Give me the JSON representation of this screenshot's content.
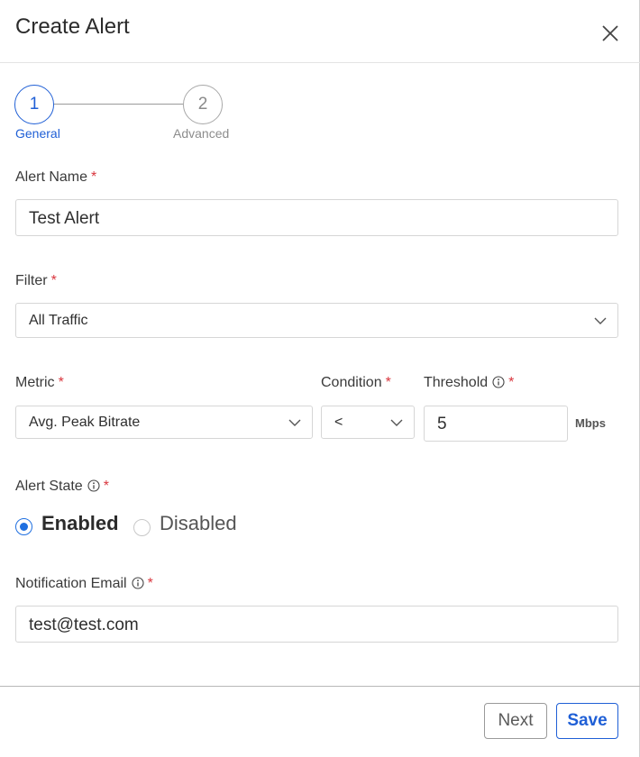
{
  "dialog": {
    "title": "Create Alert",
    "close_icon": "close-icon"
  },
  "stepper": {
    "steps": [
      {
        "number": "1",
        "label": "General",
        "active": true
      },
      {
        "number": "2",
        "label": "Advanced",
        "active": false
      }
    ]
  },
  "form": {
    "required_mark": "*",
    "alert_name": {
      "label": "Alert Name",
      "value": "Test Alert"
    },
    "filter": {
      "label": "Filter",
      "selected": "All Traffic"
    },
    "metric": {
      "label": "Metric",
      "selected": "Avg. Peak Bitrate"
    },
    "condition": {
      "label": "Condition",
      "selected": "<"
    },
    "threshold": {
      "label": "Threshold",
      "value": "5",
      "unit": "Mbps"
    },
    "alert_state": {
      "label": "Alert State",
      "options": [
        {
          "label": "Enabled",
          "checked": true
        },
        {
          "label": "Disabled",
          "checked": false
        }
      ]
    },
    "notification_email": {
      "label": "Notification Email",
      "value": "test@test.com"
    }
  },
  "footer": {
    "next_label": "Next",
    "save_label": "Save"
  },
  "colors": {
    "accent": "#1f5fd6",
    "required": "#d9363e",
    "radio_checked": "#1f6fe0"
  }
}
